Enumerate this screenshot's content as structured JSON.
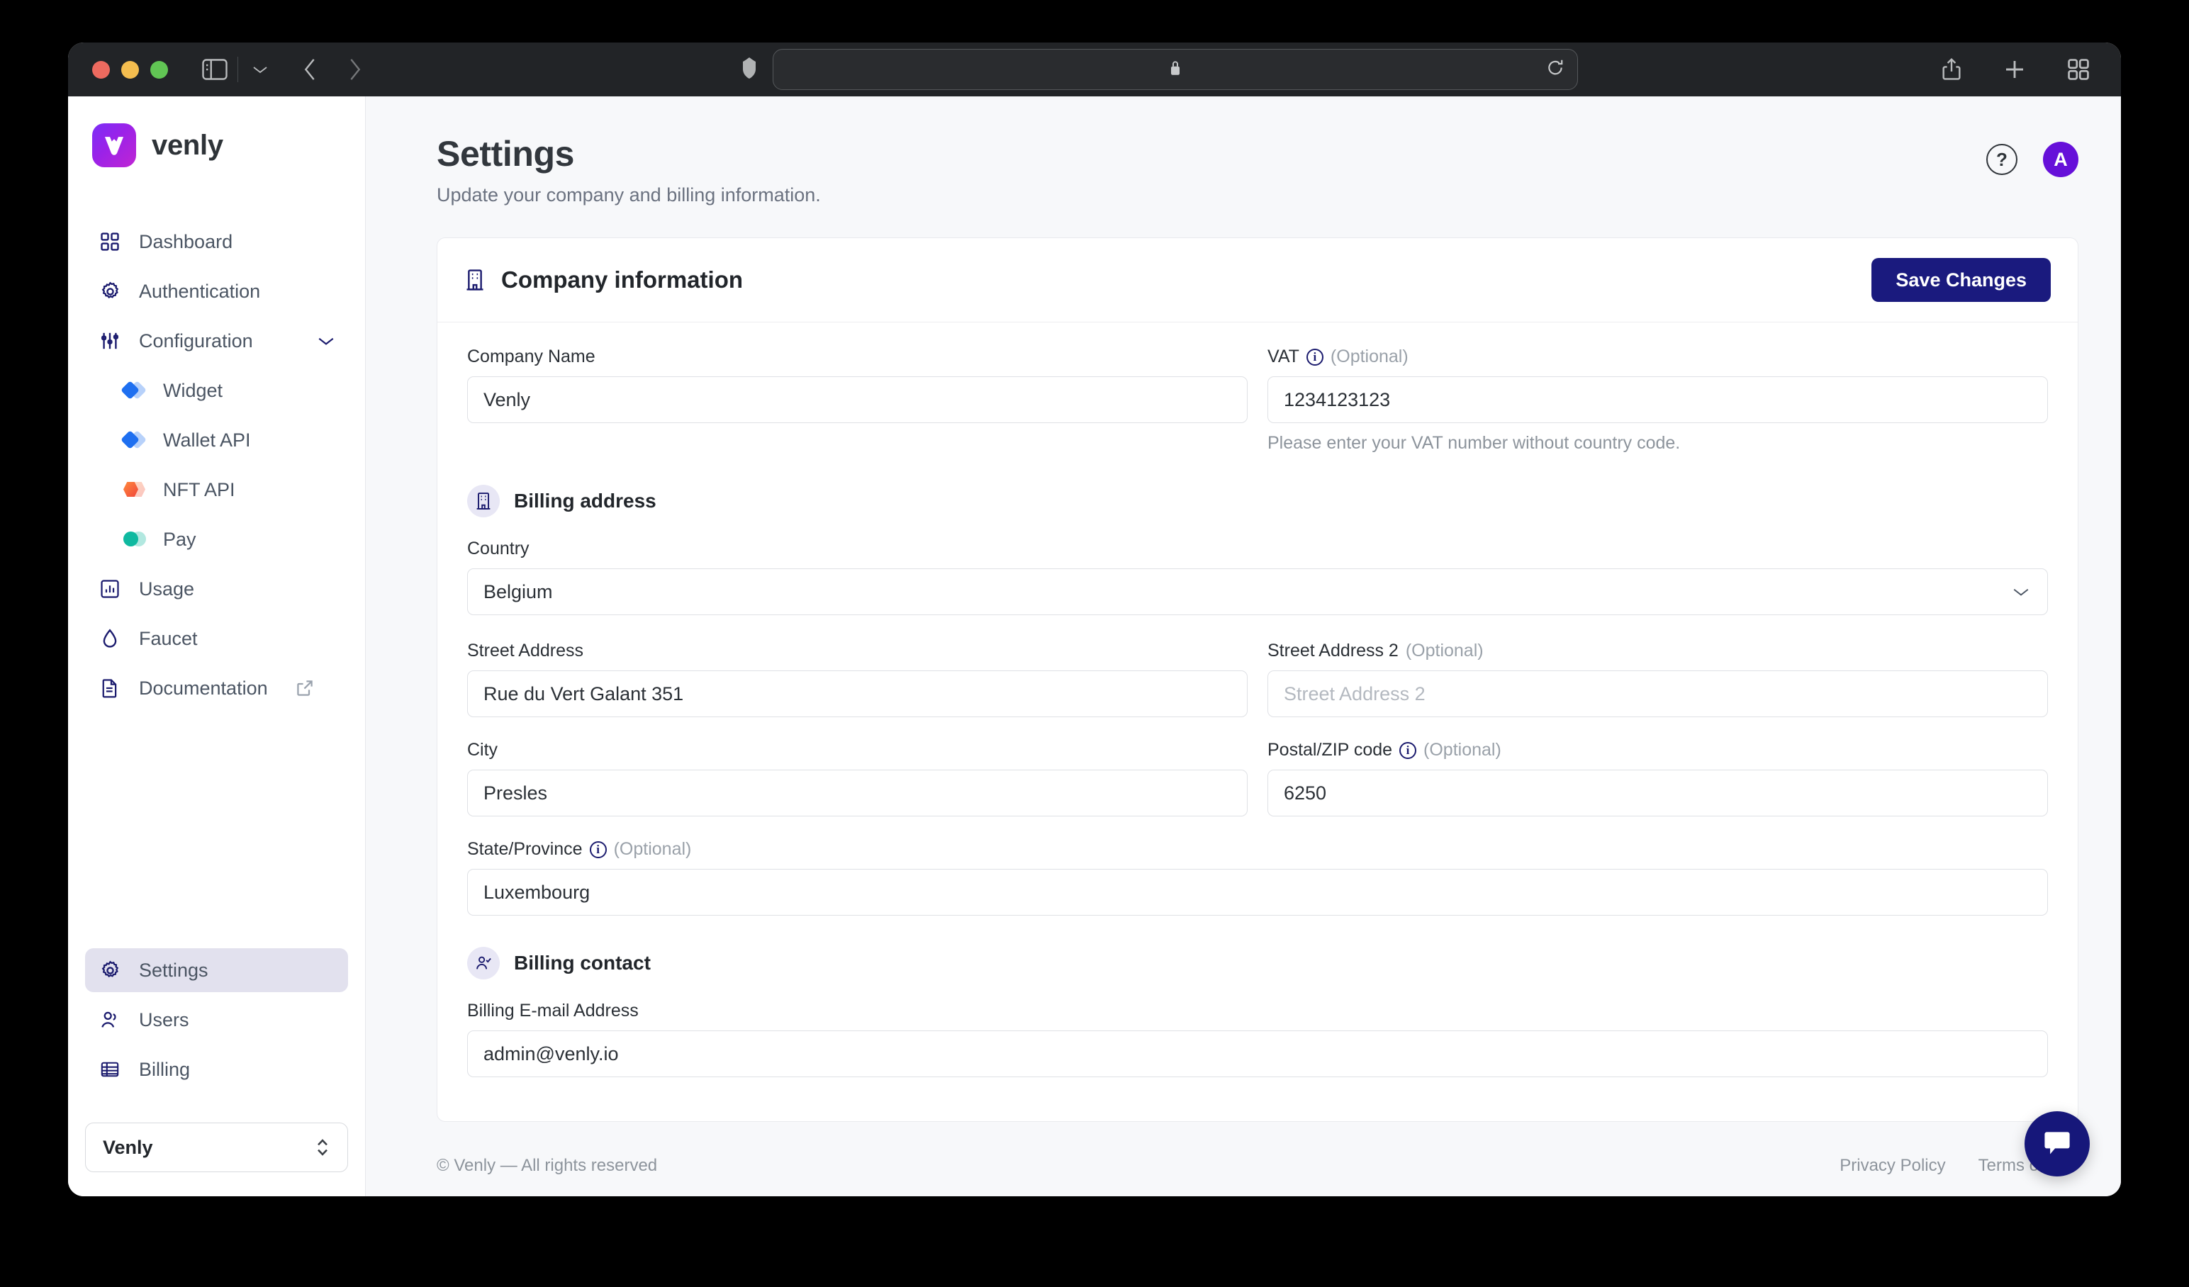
{
  "browser": {
    "traffic_lights": [
      "close",
      "minimize",
      "zoom"
    ],
    "sidebar_toggle": "sidebar-toggle-icon",
    "tab_chevron": "chevron-down-icon",
    "back": "back-arrow-icon",
    "forward": "forward-arrow-icon",
    "shield": "shield-icon",
    "url_value": "",
    "url_placeholder": "",
    "lock": "lock-icon",
    "reload": "reload-icon",
    "share": "share-icon",
    "new_tab": "plus-icon",
    "tab_overview": "tab-overview-icon"
  },
  "sidebar": {
    "brand": {
      "name": "venly",
      "mark": "venly-logo-icon"
    },
    "items": [
      {
        "label": "Dashboard",
        "icon": "grid-icon"
      },
      {
        "label": "Authentication",
        "icon": "gear-icon"
      },
      {
        "label": "Configuration",
        "icon": "sliders-icon",
        "expanded": true
      }
    ],
    "sub_items": [
      {
        "label": "Widget",
        "icon": "blue-diamond-icon"
      },
      {
        "label": "Wallet API",
        "icon": "blue-diamond-icon"
      },
      {
        "label": "NFT API",
        "icon": "orange-hexagon-icon"
      },
      {
        "label": "Pay",
        "icon": "teal-circle-icon"
      }
    ],
    "items_after": [
      {
        "label": "Usage",
        "icon": "bar-chart-icon"
      },
      {
        "label": "Faucet",
        "icon": "droplet-icon"
      },
      {
        "label": "Documentation",
        "icon": "document-icon",
        "external": true
      }
    ],
    "bottom_items": [
      {
        "label": "Settings",
        "icon": "gear-icon",
        "active": true
      },
      {
        "label": "Users",
        "icon": "users-icon"
      },
      {
        "label": "Billing",
        "icon": "billing-icon"
      }
    ],
    "org_switcher": {
      "name": "Venly",
      "icon": "up-down-chevron-icon"
    }
  },
  "header": {
    "title": "Settings",
    "subtitle": "Update your company and billing information.",
    "help_label": "?",
    "avatar_initial": "A"
  },
  "card": {
    "title": "Company information",
    "title_icon": "building-icon",
    "save_label": "Save Changes"
  },
  "form": {
    "company_name": {
      "label": "Company Name",
      "value": "Venly"
    },
    "vat": {
      "label": "VAT",
      "optional": "(Optional)",
      "value": "1234123123",
      "helper": "Please enter your VAT number without country code."
    },
    "billing_address_section": {
      "title": "Billing address",
      "icon": "building-icon"
    },
    "country": {
      "label": "Country",
      "value": "Belgium",
      "caret": "chevron-down-icon"
    },
    "street_address": {
      "label": "Street Address",
      "value": "Rue du Vert Galant 351"
    },
    "street_address_2": {
      "label": "Street Address 2",
      "optional": "(Optional)",
      "value": "",
      "placeholder": "Street Address 2"
    },
    "city": {
      "label": "City",
      "value": "Presles"
    },
    "postal_code": {
      "label": "Postal/ZIP code",
      "optional": "(Optional)",
      "value": "6250"
    },
    "state_province": {
      "label": "State/Province",
      "optional": "(Optional)",
      "value": "Luxembourg"
    },
    "billing_contact_section": {
      "title": "Billing contact",
      "icon": "person-check-icon"
    },
    "billing_email": {
      "label": "Billing E-mail Address",
      "value": "admin@venly.io"
    }
  },
  "footer": {
    "copyright": "© Venly — All rights reserved",
    "links": [
      {
        "label": "Privacy Policy"
      },
      {
        "label": "Terms of Use"
      }
    ]
  },
  "chat": {
    "icon": "chat-bubble-icon"
  },
  "colors": {
    "primary_navy": "#1a1a7e",
    "accent_purple": "#6610d9",
    "active_nav_bg": "#e2e1ee",
    "page_bg": "#f7f8fa",
    "toolbar_bg": "#222427"
  }
}
